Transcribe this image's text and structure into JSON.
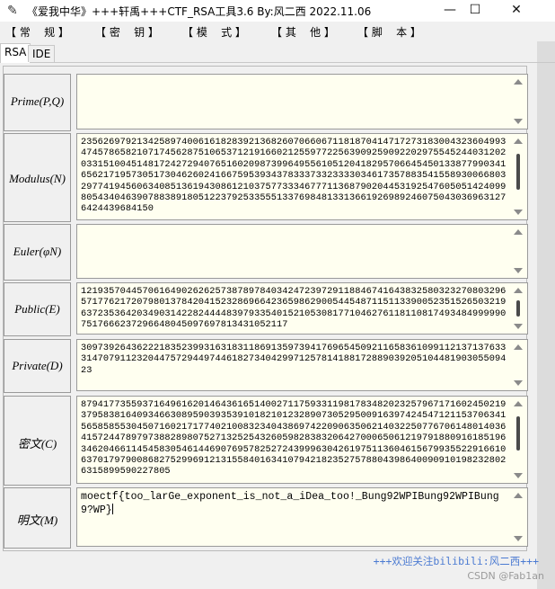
{
  "window": {
    "title": "《爱我中华》+++轩禹+++CTF_RSA工具3.6   By:风二西 2022.11.06",
    "minimize_glyph": "—",
    "maximize_glyph": "☐",
    "close_glyph": "✕",
    "app_icon_glyph": "✎"
  },
  "menu": {
    "items": [
      {
        "label": "【 常    规 】"
      },
      {
        "label": "【 密    钥 】"
      },
      {
        "label": "【 模    式 】"
      },
      {
        "label": "【 其    他 】"
      },
      {
        "label": "【 脚    本 】"
      }
    ]
  },
  "tabs": [
    {
      "label": "RSA"
    },
    {
      "label": "IDE"
    }
  ],
  "fields": {
    "prime": {
      "label": "Prime(P,Q)",
      "value": ""
    },
    "modulus": {
      "label": "Modulus(N)",
      "value": "2356269792134258974006161828392136826070660671181870414717273183004323604993474578658210717456287510653712191660212559772256390925909220297554524403120203315100451481724272940765160209873996495561051204182957066454501338779903416562171957305173046260241667595393437833373323333034617357883541558930066803297741945606340851361943086121037577333467771136879020445319254760505142409980543404639078838918051223792533555133769848133136619269892460750430369631276424439684150"
    },
    "euler": {
      "label": "Euler(φN)",
      "value": ""
    },
    "public": {
      "label": "Public(E)",
      "value": "1219357044570616490262625738789784034247239729118846741643832580323270803296571776217207980137842041523286966423659862900544548711511339005235152650321963723536420349031422824444839793354015210530817710462761181108174934849999907517666237296648045097697813431052117"
    },
    "private": {
      "label": "Private(D)",
      "value": "3097392643622218352399316318311869135973941769654509211658361099112137137633314707911232044757294497446182734042997125781418817288903920510448190305509423"
    },
    "ciphertext": {
      "label": "密文(C)",
      "value": "8794177355937164961620146436165140027117593311981783482023257967171602450219379583816409346630895903935391018210123289073052950091639742454712115370634156585855304507160217177402100832340438697422090635062140322507767061480140364157244789797388289807527132525432605982838320642700065061219791880916185196346204661145458305461446907695782527243999630426197511360461567993552291661063701797900868275299691213155840163410794218235275788043986400909101982328026315899590227805"
    },
    "plaintext": {
      "label": "明文(M)",
      "value": "moectf{too_larGe_exponent_is_not_a_iDea_too!_Bung92WPIBung92WPIBung9?WP}"
    }
  },
  "footer": {
    "text": "+++欢迎关注bilibili:风二西+++",
    "watermark": "CSDN @Fab1an"
  }
}
